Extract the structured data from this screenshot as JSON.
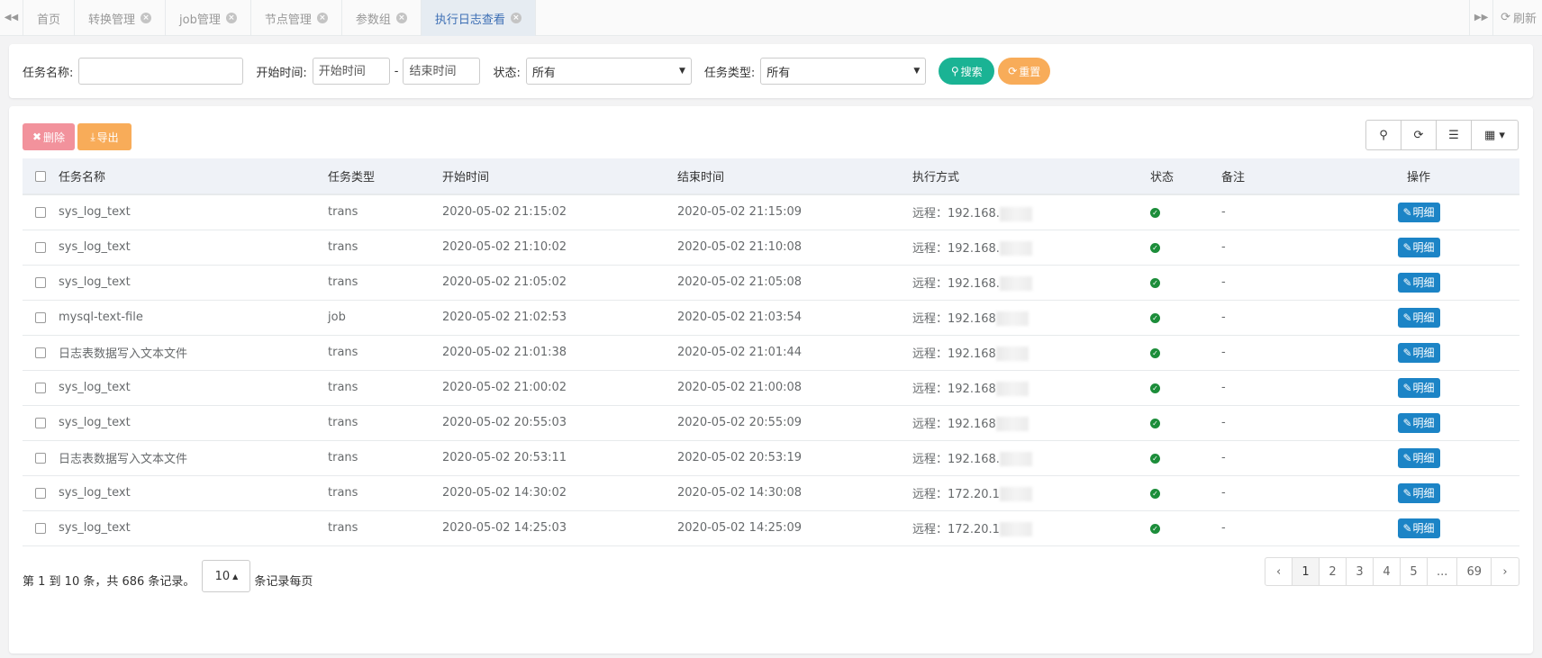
{
  "tabbar": {
    "tabs": [
      {
        "label": "首页",
        "closable": false
      },
      {
        "label": "转换管理",
        "closable": true
      },
      {
        "label": "job管理",
        "closable": true
      },
      {
        "label": "节点管理",
        "closable": true
      },
      {
        "label": "参数组",
        "closable": true
      },
      {
        "label": "执行日志查看",
        "closable": true,
        "active": true
      }
    ],
    "refresh_label": "刷新"
  },
  "search": {
    "task_name_label": "任务名称:",
    "task_name_value": "",
    "start_time_label": "开始时间:",
    "start_placeholder": "开始时间",
    "range_sep": "-",
    "end_placeholder": "结束时间",
    "status_label": "状态:",
    "status_value": "所有",
    "task_type_label": "任务类型:",
    "task_type_value": "所有",
    "search_button": "搜索",
    "reset_button": "重置"
  },
  "toolbar": {
    "delete_button": "删除",
    "export_button": "导出"
  },
  "table": {
    "columns": [
      "任务名称",
      "任务类型",
      "开始时间",
      "结束时间",
      "执行方式",
      "状态",
      "备注",
      "操作"
    ],
    "detail_label": "明细",
    "rows": [
      {
        "name": "sys_log_text",
        "type": "trans",
        "start": "2020-05-02 21:15:02",
        "end": "2020-05-02 21:15:09",
        "exec": "远程：192.168.",
        "status": "success",
        "remark": "-"
      },
      {
        "name": "sys_log_text",
        "type": "trans",
        "start": "2020-05-02 21:10:02",
        "end": "2020-05-02 21:10:08",
        "exec": "远程：192.168.",
        "status": "success",
        "remark": "-"
      },
      {
        "name": "sys_log_text",
        "type": "trans",
        "start": "2020-05-02 21:05:02",
        "end": "2020-05-02 21:05:08",
        "exec": "远程：192.168.",
        "status": "success",
        "remark": "-"
      },
      {
        "name": "mysql-text-file",
        "type": "job",
        "start": "2020-05-02 21:02:53",
        "end": "2020-05-02 21:03:54",
        "exec": "远程：192.168",
        "status": "success",
        "remark": "-"
      },
      {
        "name": "日志表数据写入文本文件",
        "type": "trans",
        "start": "2020-05-02 21:01:38",
        "end": "2020-05-02 21:01:44",
        "exec": "远程：192.168",
        "status": "success",
        "remark": "-"
      },
      {
        "name": "sys_log_text",
        "type": "trans",
        "start": "2020-05-02 21:00:02",
        "end": "2020-05-02 21:00:08",
        "exec": "远程：192.168",
        "status": "success",
        "remark": "-"
      },
      {
        "name": "sys_log_text",
        "type": "trans",
        "start": "2020-05-02 20:55:03",
        "end": "2020-05-02 20:55:09",
        "exec": "远程：192.168",
        "status": "success",
        "remark": "-"
      },
      {
        "name": "日志表数据写入文本文件",
        "type": "trans",
        "start": "2020-05-02 20:53:11",
        "end": "2020-05-02 20:53:19",
        "exec": "远程：192.168.",
        "status": "success",
        "remark": "-"
      },
      {
        "name": "sys_log_text",
        "type": "trans",
        "start": "2020-05-02 14:30:02",
        "end": "2020-05-02 14:30:08",
        "exec": "远程：172.20.1",
        "status": "success",
        "remark": "-"
      },
      {
        "name": "sys_log_text",
        "type": "trans",
        "start": "2020-05-02 14:25:03",
        "end": "2020-05-02 14:25:09",
        "exec": "远程：172.20.1",
        "status": "success",
        "remark": "-"
      }
    ]
  },
  "footer": {
    "summary": "第 1 到 10 条，共 686 条记录。",
    "page_size": "10",
    "page_size_suffix": "条记录每页",
    "pages": [
      "‹",
      "1",
      "2",
      "3",
      "4",
      "5",
      "...",
      "69",
      "›"
    ],
    "current_page": "1"
  },
  "colors": {
    "search_button": "#1ab394",
    "reset_button": "#f8ac59",
    "delete_button": "#f28d97",
    "detail_button": "#1c84c6",
    "status_success": "#1c8d3a"
  }
}
